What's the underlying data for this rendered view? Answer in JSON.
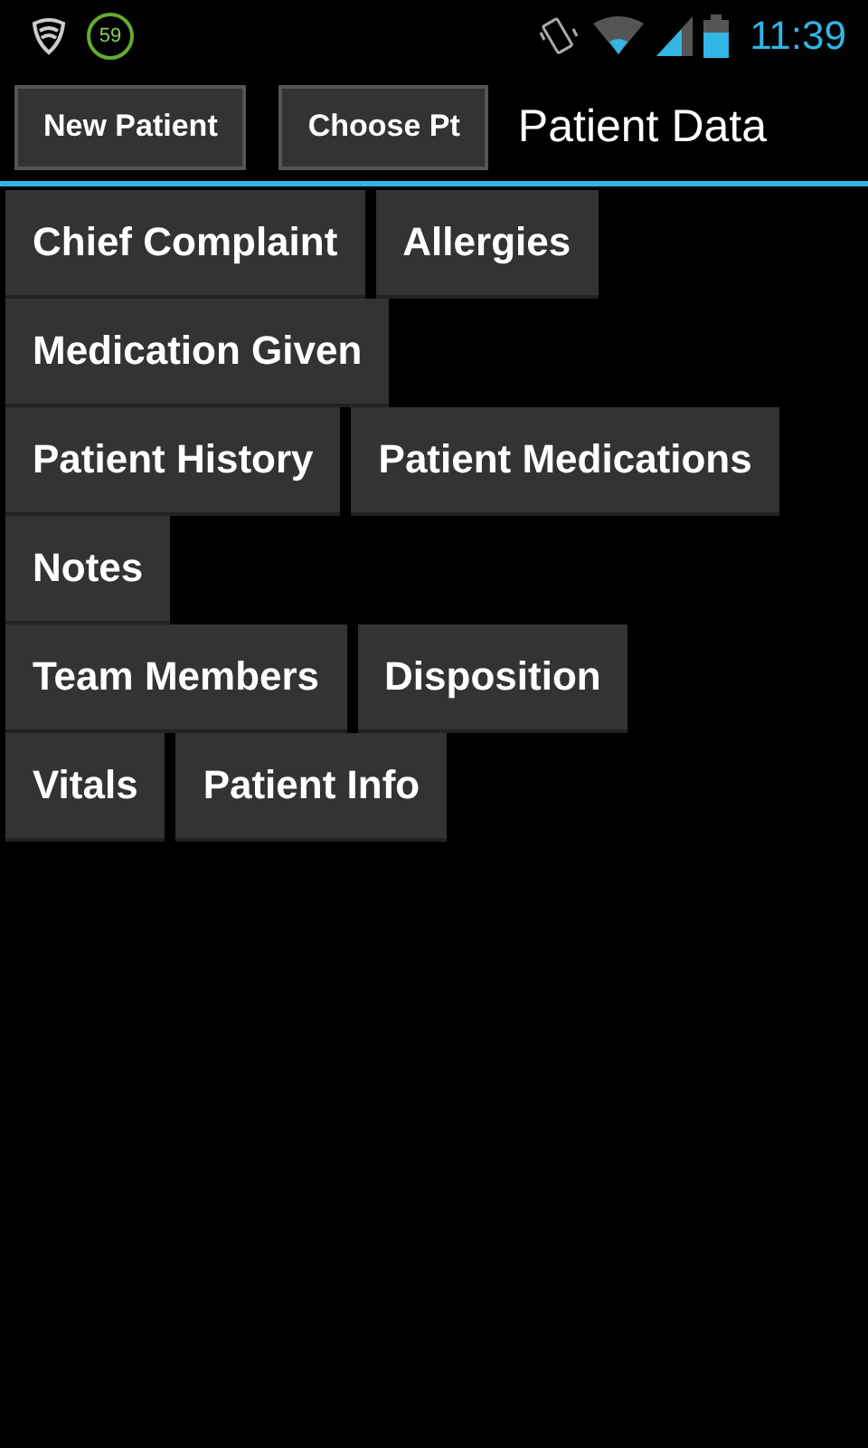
{
  "status_bar": {
    "notification_count": "59",
    "time": "11:39"
  },
  "header": {
    "buttons": [
      "New Patient",
      "Choose Pt"
    ],
    "title": "Patient Data"
  },
  "rows": [
    [
      "Chief Complaint",
      "Allergies"
    ],
    [
      "Medication Given"
    ],
    [
      "Patient History",
      "Patient Medications"
    ],
    [
      "Notes"
    ],
    [
      "Team Members",
      "Disposition"
    ],
    [
      "Vitals",
      "Patient Info"
    ]
  ]
}
